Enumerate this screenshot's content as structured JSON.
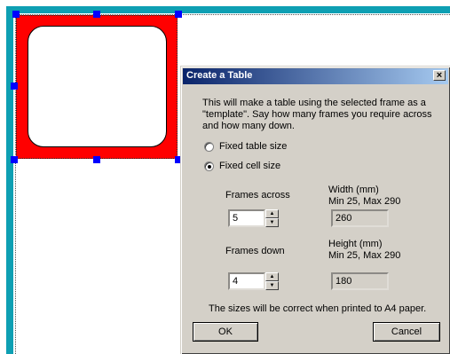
{
  "dialog": {
    "title": "Create a Table",
    "close_glyph": "×",
    "description": "This will make a table using the selected frame as a \"template\".  Say how many frames you require across and how many down.",
    "options": {
      "fixed_table_label": "Fixed table size",
      "fixed_cell_label": "Fixed cell size",
      "selected": "fixed_cell"
    },
    "frames_across": {
      "label": "Frames across",
      "value": "5"
    },
    "frames_down": {
      "label": "Frames down",
      "value": "4"
    },
    "width": {
      "label": "Width (mm)",
      "range": "Min 25, Max 290",
      "value": "260"
    },
    "height": {
      "label": "Height (mm)",
      "range": "Min 25, Max 290",
      "value": "180"
    },
    "note": "The sizes will be correct when  printed to A4 paper.",
    "ok_label": "OK",
    "cancel_label": "Cancel"
  },
  "colors": {
    "frame_fill": "#ff0000",
    "handle": "#0000ff",
    "ruler": "#0e9fb3",
    "titlebar_start": "#0a246a",
    "titlebar_end": "#a6caf0"
  }
}
